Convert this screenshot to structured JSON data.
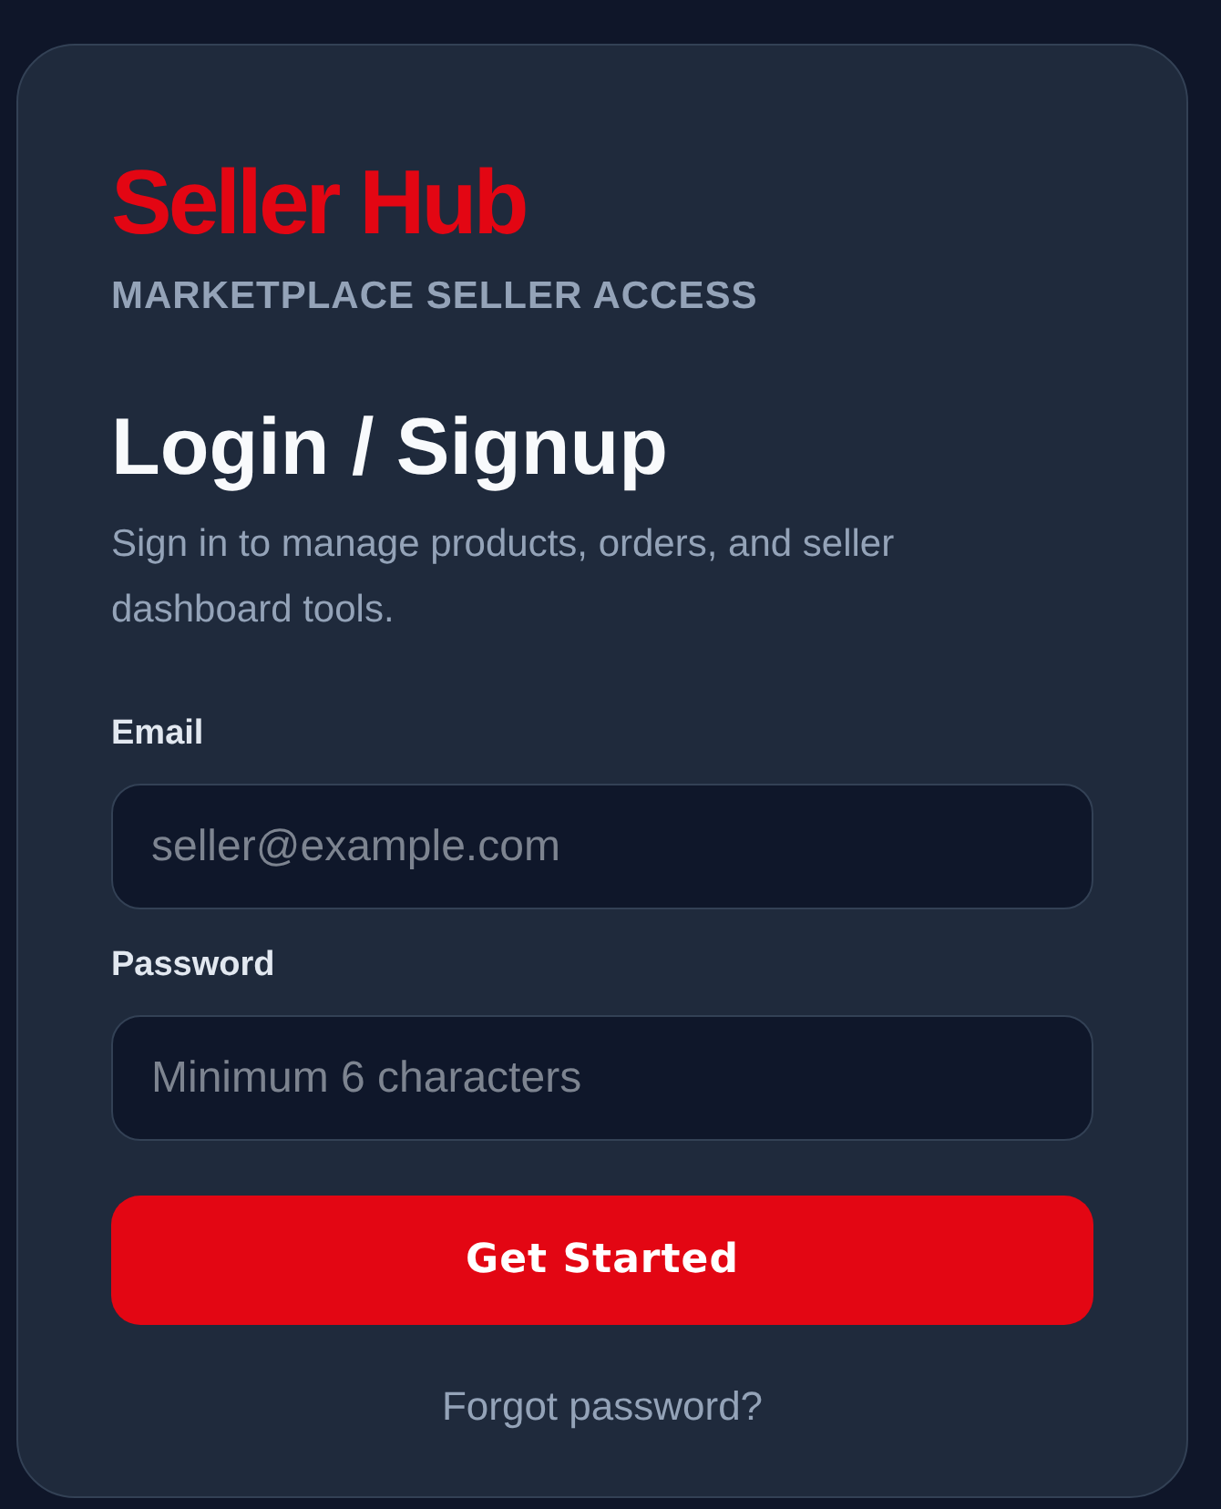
{
  "brand": {
    "logo": "Seller Hub",
    "tagline": "MARKETPLACE SELLER ACCESS"
  },
  "heading": "Login / Signup",
  "description": "Sign in to manage products, orders, and seller dashboard tools.",
  "fields": [
    {
      "label": "Email",
      "placeholder": "seller@example.com"
    },
    {
      "label": "Password",
      "placeholder": "Minimum 6 characters"
    }
  ],
  "submit_button": "Get Started",
  "forgot_link": "Forgot password?"
}
